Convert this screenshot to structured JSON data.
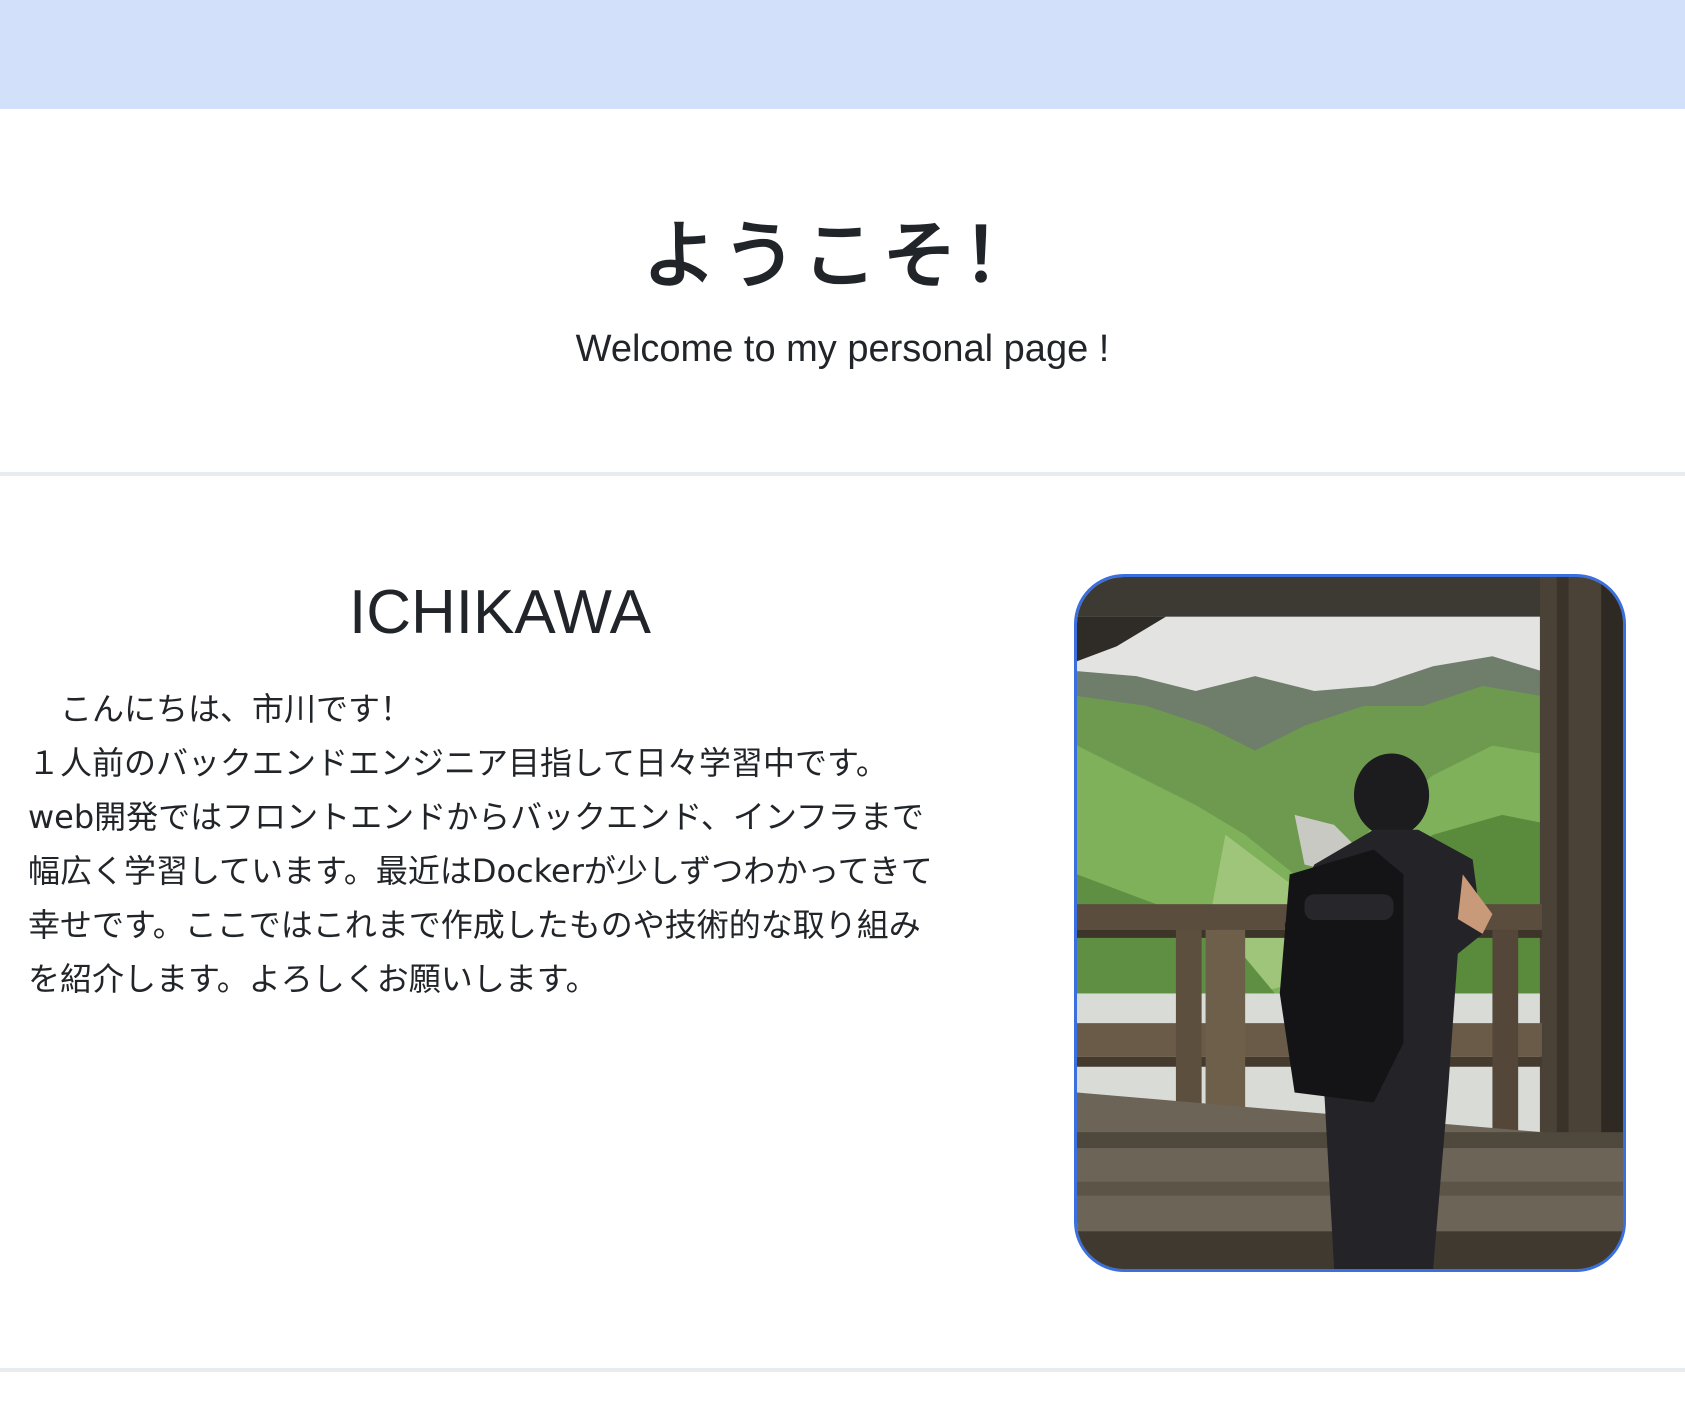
{
  "hero": {
    "title": "ようこそ！",
    "subtitle": "Welcome to my personal page !"
  },
  "profile": {
    "name": "ICHIKAWA",
    "lines": [
      "　こんにちは、市川です！",
      "１人前のバックエンドエンジニア目指して日々学習中です。",
      "web開発ではフロントエンドからバックエンド、インフラまで",
      "幅広く学習しています。最近はDockerが少しずつわかってきて",
      "幸せです。ここではこれまで作成したものや技術的な取り組み",
      "を紹介します。よろしくお願いします。"
    ],
    "photo_icon": "profile-photo"
  },
  "colors": {
    "top_band": "#d3e0fa",
    "photo_border": "#3a6fe0",
    "divider": "#e9ecef",
    "text": "#212529"
  }
}
